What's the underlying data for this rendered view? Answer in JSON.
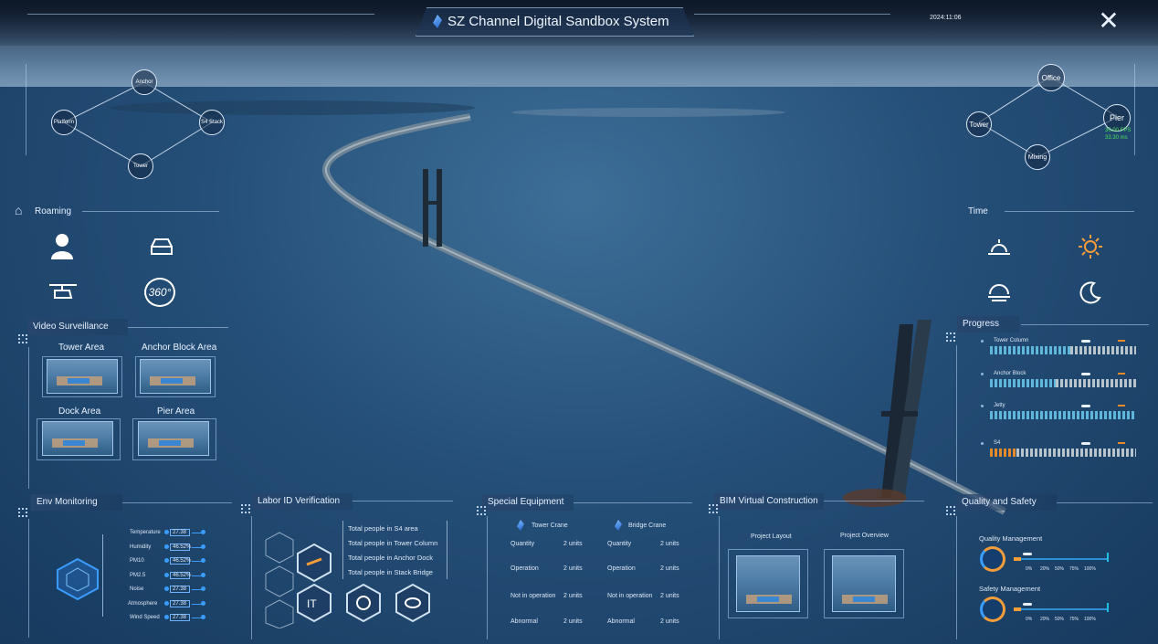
{
  "header": {
    "title": "SZ Channel Digital Sandbox System",
    "date": "2024:11:06",
    "close_icon": "close-icon"
  },
  "nav_left": {
    "nodes": [
      "Anchor",
      "Platform",
      "S4 Stack",
      "Tower"
    ]
  },
  "nav_right": {
    "nodes": [
      "Office",
      "Tower",
      "Pier",
      "Mixing"
    ],
    "fps": "30.00 FPS",
    "ms": "33.30 ms"
  },
  "roaming": {
    "label": "Roaming",
    "buttons": [
      "person-icon",
      "car-icon",
      "helicopter-icon",
      "360-icon"
    ],
    "icon360_text": "360°"
  },
  "time": {
    "label": "Time",
    "buttons": [
      "sunrise-icon",
      "sun-icon",
      "sunset-icon",
      "moon-icon"
    ]
  },
  "video": {
    "label": "Video Surveillance",
    "areas": [
      "Tower Area",
      "Anchor Block Area",
      "Dock Area",
      "Pier Area"
    ]
  },
  "progress": {
    "label": "Progress",
    "items": [
      {
        "name": "Tower Column",
        "value": 0.55
      },
      {
        "name": "Anchor Block",
        "value": 0.45
      },
      {
        "name": "Jetty",
        "value": 1.0
      },
      {
        "name": "S4",
        "value": 0.18
      }
    ]
  },
  "env": {
    "label": "Env Monitoring",
    "rows": [
      {
        "name": "Temperature",
        "value": "27.38"
      },
      {
        "name": "Humidity",
        "value": "46.52%"
      },
      {
        "name": "PM10",
        "value": "46.52%"
      },
      {
        "name": "PM2.5",
        "value": "46.52%"
      },
      {
        "name": "Noise",
        "value": "27.38"
      },
      {
        "name": "Atmosphere",
        "value": "27.38"
      },
      {
        "name": "Wind Speed",
        "value": "27.38"
      }
    ]
  },
  "labor": {
    "label": "Labor ID Verification",
    "lines": [
      "Total people in S4 area",
      "Total people in Tower Column",
      "Total people in Anchor Dock",
      "Total people in Stack Bridge"
    ]
  },
  "equipment": {
    "label": "Special Equipment",
    "col1_title": "Tower Crane",
    "col2_title": "Bridge Crane",
    "rows": [
      {
        "name": "Quantity",
        "v1": "2 units",
        "v2": "2 units"
      },
      {
        "name": "Operation",
        "v1": "2 units",
        "v2": "2 units"
      },
      {
        "name": "Not in operation",
        "v1": "2 units",
        "v2": "2 units"
      },
      {
        "name": "Abnormal",
        "v1": "2 units",
        "v2": "2 units"
      }
    ]
  },
  "bim": {
    "label": "BIM Virtual Construction",
    "items": [
      "Project Layout",
      "Project Overview"
    ]
  },
  "quality": {
    "label": "Quality and Safety",
    "items": [
      {
        "name": "Quality Management",
        "value": 0.08
      },
      {
        "name": "Safety Management",
        "value": 0.08
      }
    ],
    "scale": [
      "0%",
      "20%",
      "50%",
      "75%",
      "100%"
    ]
  }
}
